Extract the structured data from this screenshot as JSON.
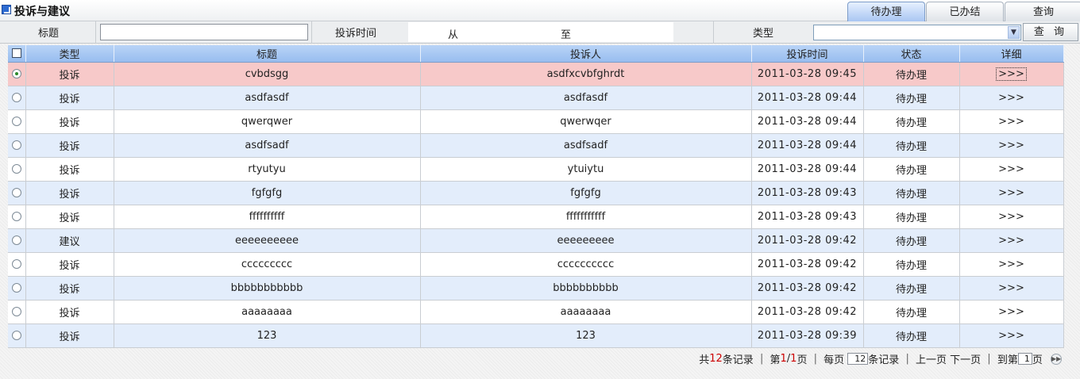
{
  "header": {
    "title": "投诉与建议",
    "tabs": [
      {
        "label": "待办理",
        "active": true
      },
      {
        "label": "已办结",
        "active": false
      },
      {
        "label": "查询",
        "active": false
      }
    ]
  },
  "filter": {
    "title_label": "标题",
    "title_value": "",
    "time_label": "投诉时间",
    "from_label": "从",
    "to_label": "至",
    "type_label": "类型",
    "type_value": "",
    "query_button": "查 询"
  },
  "table": {
    "columns": [
      "类型",
      "标题",
      "投诉人",
      "投诉时间",
      "状态",
      "详细"
    ],
    "rows": [
      {
        "type": "投诉",
        "title": "cvbdsgg",
        "complainant": "asdfxcvbfghrdt",
        "time": "2011-03-28 09:45",
        "status": "待办理",
        "detail": ">>>"
      },
      {
        "type": "投诉",
        "title": "asdfasdf",
        "complainant": "asdfasdf",
        "time": "2011-03-28 09:44",
        "status": "待办理",
        "detail": ">>>"
      },
      {
        "type": "投诉",
        "title": "qwerqwer",
        "complainant": "qwerwqer",
        "time": "2011-03-28 09:44",
        "status": "待办理",
        "detail": ">>>"
      },
      {
        "type": "投诉",
        "title": "asdfsadf",
        "complainant": "asdfsadf",
        "time": "2011-03-28 09:44",
        "status": "待办理",
        "detail": ">>>"
      },
      {
        "type": "投诉",
        "title": "rtyutyu",
        "complainant": "ytuiytu",
        "time": "2011-03-28 09:44",
        "status": "待办理",
        "detail": ">>>"
      },
      {
        "type": "投诉",
        "title": "fgfgfg",
        "complainant": "fgfgfg",
        "time": "2011-03-28 09:43",
        "status": "待办理",
        "detail": ">>>"
      },
      {
        "type": "投诉",
        "title": "ffffffffff",
        "complainant": "fffffffffff",
        "time": "2011-03-28 09:43",
        "status": "待办理",
        "detail": ">>>"
      },
      {
        "type": "建议",
        "title": "eeeeeeeeee",
        "complainant": "eeeeeeeee",
        "time": "2011-03-28 09:42",
        "status": "待办理",
        "detail": ">>>"
      },
      {
        "type": "投诉",
        "title": "ccccccccc",
        "complainant": "cccccccccc",
        "time": "2011-03-28 09:42",
        "status": "待办理",
        "detail": ">>>"
      },
      {
        "type": "投诉",
        "title": "bbbbbbbbbbb",
        "complainant": "bbbbbbbbbb",
        "time": "2011-03-28 09:42",
        "status": "待办理",
        "detail": ">>>"
      },
      {
        "type": "投诉",
        "title": "aaaaaaaa",
        "complainant": "aaaaaaaa",
        "time": "2011-03-28 09:42",
        "status": "待办理",
        "detail": ">>>"
      },
      {
        "type": "投诉",
        "title": "123",
        "complainant": "123",
        "time": "2011-03-28 09:39",
        "status": "待办理",
        "detail": ">>>"
      }
    ],
    "selected_index": 0
  },
  "pager": {
    "total_prefix": "共",
    "total_count": "12",
    "total_suffix": "条记录",
    "page_prefix": "第",
    "current_page": "1",
    "page_slash": "/",
    "total_pages": "1",
    "page_suffix": "页",
    "per_page_label": "每页",
    "per_page_value": "12",
    "per_page_suffix": "条记录",
    "prev_label": "上一页",
    "next_label": "下一页",
    "goto_prefix": "到第",
    "goto_value": "1",
    "goto_suffix": "页"
  },
  "colors": {
    "header_blue": "#a9c6f2",
    "selected_row": "#f7c9c9",
    "alt_row": "#e3edfb",
    "accent_red": "#cc0000"
  }
}
